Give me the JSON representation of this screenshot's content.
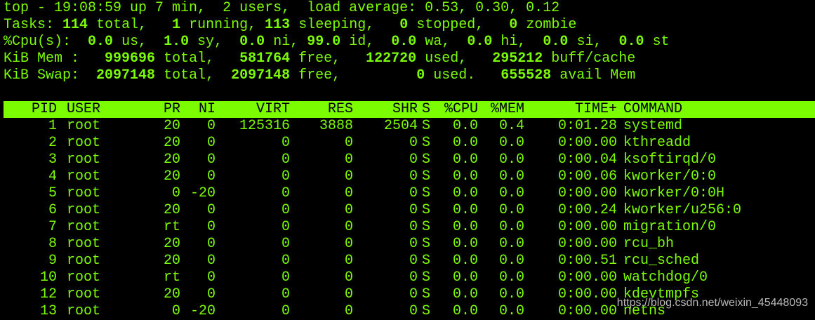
{
  "summary": {
    "top": {
      "prefix": "top - ",
      "time": "19:08:59",
      "uptime": " up 7 min, ",
      "users": " 2 users, ",
      "load_label": " load average: ",
      "load": "0.53, 0.30, 0.12"
    },
    "tasks": {
      "label": "Tasks:",
      "total": "114",
      "total_label": "total,",
      "running": "1",
      "running_label": "running,",
      "sleeping": "113",
      "sleeping_label": "sleeping,",
      "stopped": "0",
      "stopped_label": "stopped,",
      "zombie": "0",
      "zombie_label": "zombie"
    },
    "cpu": {
      "label": "%Cpu(s):",
      "us": "0.0",
      "us_label": "us,",
      "sy": "1.0",
      "sy_label": "sy,",
      "ni": "0.0",
      "ni_label": "ni,",
      "id": "99.0",
      "id_label": "id,",
      "wa": "0.0",
      "wa_label": "wa,",
      "hi": "0.0",
      "hi_label": "hi,",
      "si": "0.0",
      "si_label": "si,",
      "st": "0.0",
      "st_label": "st"
    },
    "mem": {
      "label": "KiB Mem :",
      "total": "999696",
      "total_label": "total,",
      "free": "581764",
      "free_label": "free,",
      "used": "122720",
      "used_label": "used,",
      "buff": "295212",
      "buff_label": "buff/cache"
    },
    "swap": {
      "label": "KiB Swap:",
      "total": "2097148",
      "total_label": "total,",
      "free": "2097148",
      "free_label": "free,",
      "used": "0",
      "used_label": "used.",
      "avail": "655528",
      "avail_label": "avail Mem"
    }
  },
  "table": {
    "headers": [
      "PID",
      "USER",
      "PR",
      "NI",
      "VIRT",
      "RES",
      "SHR",
      "S",
      "%CPU",
      "%MEM",
      "TIME+",
      "COMMAND"
    ],
    "rows": [
      [
        "1",
        "root",
        "20",
        "0",
        "125316",
        "3888",
        "2504",
        "S",
        "0.0",
        "0.4",
        "0:01.28",
        "systemd"
      ],
      [
        "2",
        "root",
        "20",
        "0",
        "0",
        "0",
        "0",
        "S",
        "0.0",
        "0.0",
        "0:00.00",
        "kthreadd"
      ],
      [
        "3",
        "root",
        "20",
        "0",
        "0",
        "0",
        "0",
        "S",
        "0.0",
        "0.0",
        "0:00.04",
        "ksoftirqd/0"
      ],
      [
        "4",
        "root",
        "20",
        "0",
        "0",
        "0",
        "0",
        "S",
        "0.0",
        "0.0",
        "0:00.06",
        "kworker/0:0"
      ],
      [
        "5",
        "root",
        "0",
        "-20",
        "0",
        "0",
        "0",
        "S",
        "0.0",
        "0.0",
        "0:00.00",
        "kworker/0:0H"
      ],
      [
        "6",
        "root",
        "20",
        "0",
        "0",
        "0",
        "0",
        "S",
        "0.0",
        "0.0",
        "0:00.24",
        "kworker/u256:0"
      ],
      [
        "7",
        "root",
        "rt",
        "0",
        "0",
        "0",
        "0",
        "S",
        "0.0",
        "0.0",
        "0:00.00",
        "migration/0"
      ],
      [
        "8",
        "root",
        "20",
        "0",
        "0",
        "0",
        "0",
        "S",
        "0.0",
        "0.0",
        "0:00.00",
        "rcu_bh"
      ],
      [
        "9",
        "root",
        "20",
        "0",
        "0",
        "0",
        "0",
        "S",
        "0.0",
        "0.0",
        "0:00.51",
        "rcu_sched"
      ],
      [
        "10",
        "root",
        "rt",
        "0",
        "0",
        "0",
        "0",
        "S",
        "0.0",
        "0.0",
        "0:00.00",
        "watchdog/0"
      ],
      [
        "12",
        "root",
        "20",
        "0",
        "0",
        "0",
        "0",
        "S",
        "0.0",
        "0.0",
        "0:00.00",
        "kdevtmpfs"
      ],
      [
        "13",
        "root",
        "0",
        "-20",
        "0",
        "0",
        "0",
        "S",
        "0.0",
        "0.0",
        "0:00.00",
        "netns"
      ]
    ]
  },
  "watermark": "https://blog.csdn.net/weixin_45448093",
  "colors": {
    "background": "#000000",
    "text": "#7CFC00",
    "header_bg": "#7CFC00",
    "header_text": "#000000"
  }
}
